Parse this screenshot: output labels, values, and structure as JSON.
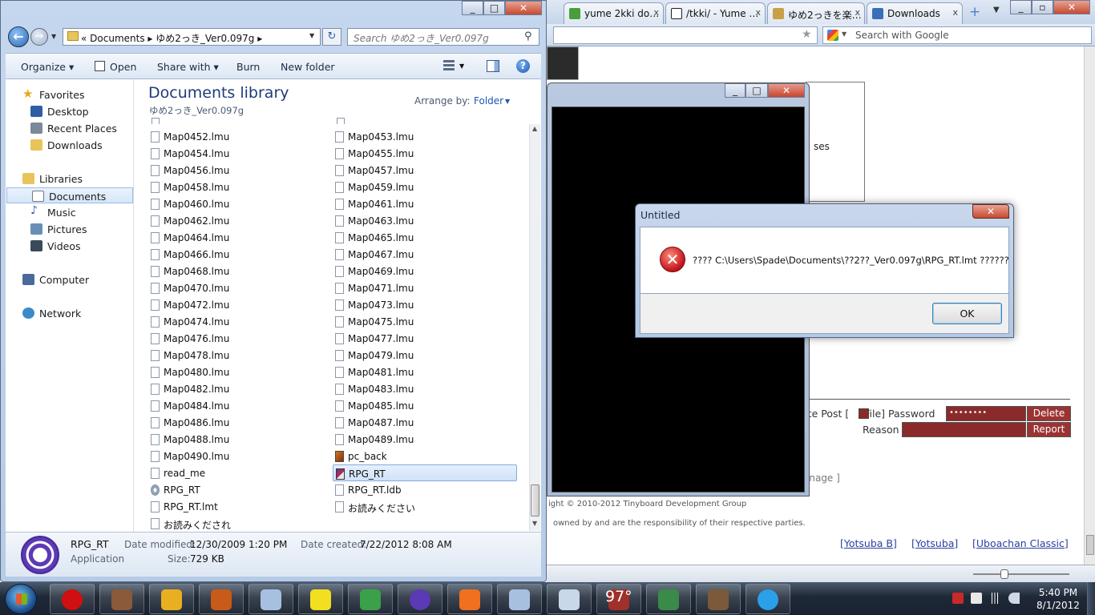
{
  "browser": {
    "tabs": [
      {
        "title": "yume 2kki do…",
        "icon_color": "#4a9d3a"
      },
      {
        "title": "/tkki/ - Yume …",
        "icon_color": "#222222"
      },
      {
        "title": "ゆめ2っきを楽…",
        "icon_color": "#c9a048"
      },
      {
        "title": "Downloads",
        "icon_color": "#3a6fb8"
      }
    ],
    "tab_close": "x",
    "new_tab": "+",
    "tab_menu": "▼",
    "search_placeholder": "Search with Google",
    "star_icon": "★",
    "page_text_fragment": "ses",
    "delete_post_label": "ete Post [",
    "file_password_label": "File] Password",
    "password_value": "••••••••",
    "delete_button": "Delete",
    "reason_label": "Reason",
    "report_button": "Report",
    "manage_fragment": "anage ]",
    "footer_copyright": "ight © 2010-2012 Tinyboard Development Group",
    "footer_owned": "owned by and are the responsibility of their respective parties.",
    "style_links": [
      "[Yotsuba B]",
      "[Yotsuba]",
      "[Uboachan Classic]"
    ]
  },
  "game_window": {
    "min_glyph": "_",
    "max_glyph": "□",
    "close_glyph": "✕"
  },
  "explorer": {
    "min_glyph": "_",
    "max_glyph": "□",
    "close_glyph": "✕",
    "back_glyph": "←",
    "fwd_glyph": "→",
    "address": "«  Documents  ▸  ゆめ2っき_Ver0.097g  ▸",
    "refresh_glyph": "↻",
    "search_placeholder": "Search ゆめ2っき_Ver0.097g",
    "search_glyph": "⚲",
    "commands": {
      "organize": "Organize ▾",
      "open": "Open",
      "share_with": "Share with ▾",
      "burn": "Burn",
      "new_folder": "New folder"
    },
    "help_glyph": "?",
    "nav": {
      "favorites": "Favorites",
      "desktop": "Desktop",
      "recent_places": "Recent Places",
      "downloads": "Downloads",
      "libraries": "Libraries",
      "documents": "Documents",
      "music": "Music",
      "pictures": "Pictures",
      "videos": "Videos",
      "computer": "Computer",
      "network": "Network"
    },
    "library_title": "Documents library",
    "library_subtitle": "ゆめ2っき_Ver0.097g",
    "arrange_label": "Arrange by:",
    "arrange_value": "Folder",
    "files_left": [
      {
        "name": "Map0452.lmu",
        "kind": "doc"
      },
      {
        "name": "Map0454.lmu",
        "kind": "doc"
      },
      {
        "name": "Map0456.lmu",
        "kind": "doc"
      },
      {
        "name": "Map0458.lmu",
        "kind": "doc"
      },
      {
        "name": "Map0460.lmu",
        "kind": "doc"
      },
      {
        "name": "Map0462.lmu",
        "kind": "doc"
      },
      {
        "name": "Map0464.lmu",
        "kind": "doc"
      },
      {
        "name": "Map0466.lmu",
        "kind": "doc"
      },
      {
        "name": "Map0468.lmu",
        "kind": "doc"
      },
      {
        "name": "Map0470.lmu",
        "kind": "doc"
      },
      {
        "name": "Map0472.lmu",
        "kind": "doc"
      },
      {
        "name": "Map0474.lmu",
        "kind": "doc"
      },
      {
        "name": "Map0476.lmu",
        "kind": "doc"
      },
      {
        "name": "Map0478.lmu",
        "kind": "doc"
      },
      {
        "name": "Map0480.lmu",
        "kind": "doc"
      },
      {
        "name": "Map0482.lmu",
        "kind": "doc"
      },
      {
        "name": "Map0484.lmu",
        "kind": "doc"
      },
      {
        "name": "Map0486.lmu",
        "kind": "doc"
      },
      {
        "name": "Map0488.lmu",
        "kind": "doc"
      },
      {
        "name": "Map0490.lmu",
        "kind": "doc"
      },
      {
        "name": "read_me",
        "kind": "doc"
      },
      {
        "name": "RPG_RT",
        "kind": "cfg"
      },
      {
        "name": "RPG_RT.lmt",
        "kind": "doc"
      },
      {
        "name": "お読みくだされ",
        "kind": "doc"
      }
    ],
    "files_right": [
      {
        "name": "Map0453.lmu",
        "kind": "doc"
      },
      {
        "name": "Map0455.lmu",
        "kind": "doc"
      },
      {
        "name": "Map0457.lmu",
        "kind": "doc"
      },
      {
        "name": "Map0459.lmu",
        "kind": "doc"
      },
      {
        "name": "Map0461.lmu",
        "kind": "doc"
      },
      {
        "name": "Map0463.lmu",
        "kind": "doc"
      },
      {
        "name": "Map0465.lmu",
        "kind": "doc"
      },
      {
        "name": "Map0467.lmu",
        "kind": "doc"
      },
      {
        "name": "Map0469.lmu",
        "kind": "doc"
      },
      {
        "name": "Map0471.lmu",
        "kind": "doc"
      },
      {
        "name": "Map0473.lmu",
        "kind": "doc"
      },
      {
        "name": "Map0475.lmu",
        "kind": "doc"
      },
      {
        "name": "Map0477.lmu",
        "kind": "doc"
      },
      {
        "name": "Map0479.lmu",
        "kind": "doc"
      },
      {
        "name": "Map0481.lmu",
        "kind": "doc"
      },
      {
        "name": "Map0483.lmu",
        "kind": "doc"
      },
      {
        "name": "Map0485.lmu",
        "kind": "doc"
      },
      {
        "name": "Map0487.lmu",
        "kind": "doc"
      },
      {
        "name": "Map0489.lmu",
        "kind": "doc"
      },
      {
        "name": "pc_back",
        "kind": "img"
      },
      {
        "name": "RPG_RT",
        "kind": "app",
        "selected": true
      },
      {
        "name": "RPG_RT.ldb",
        "kind": "doc"
      },
      {
        "name": "お読みください",
        "kind": "doc"
      }
    ],
    "details": {
      "name": "RPG_RT",
      "type": "Application",
      "date_modified_label": "Date modified:",
      "date_modified": "12/30/2009 1:20 PM",
      "size_label": "Size:",
      "size": "729 KB",
      "date_created_label": "Date created:",
      "date_created": "7/22/2012 8:08 AM"
    }
  },
  "dialog": {
    "title": "Untitled",
    "close_glyph": "✕",
    "error_glyph": "✕",
    "message": "???? C:\\Users\\Spade\\Documents\\??2??_Ver0.097g\\RPG_RT.lmt ??????",
    "ok_button": "OK"
  },
  "taskbar": {
    "items": [
      {
        "name": "opera",
        "color": "#d01010"
      },
      {
        "name": "dog-app",
        "color": "#8a5a3a"
      },
      {
        "name": "shield-app",
        "color": "#e8b020"
      },
      {
        "name": "film-app",
        "color": "#c85a1a"
      },
      {
        "name": "paint-app",
        "color": "#a8c0e0"
      },
      {
        "name": "smiley-app",
        "color": "#f2e020"
      },
      {
        "name": "messenger-app",
        "color": "#3aa04a"
      },
      {
        "name": "bittorrent-app",
        "color": "#5a3ab5"
      },
      {
        "name": "settings-app",
        "color": "#f07020"
      },
      {
        "name": "paint2-app",
        "color": "#a8c0e0"
      },
      {
        "name": "notepad-app",
        "color": "#c8d8e8"
      },
      {
        "name": "winrar-app",
        "color": "#a0302a"
      },
      {
        "name": "screen-app",
        "color": "#3a8a4a"
      },
      {
        "name": "game-app",
        "color": "#7a5a3a"
      },
      {
        "name": "skype-app",
        "color": "#2aa0e8"
      }
    ],
    "temperature": "97°",
    "time": "5:40 PM",
    "date": "8/1/2012"
  }
}
